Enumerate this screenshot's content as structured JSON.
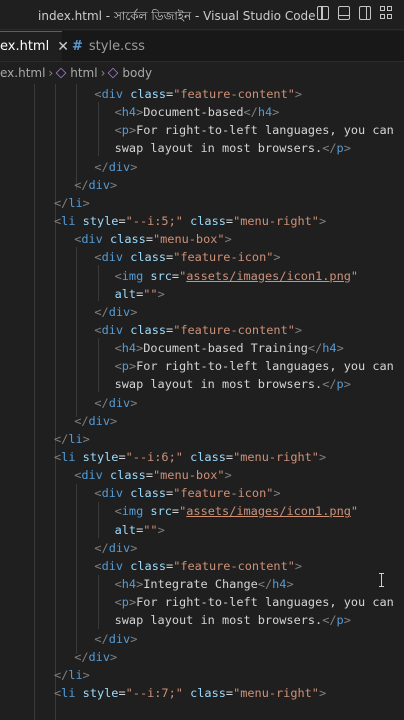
{
  "window": {
    "title": "index.html - সার্কেল ডিজাইন - Visual Studio Code"
  },
  "tabs": [
    {
      "label": "ex.html",
      "active": true,
      "close_icon": "close-icon"
    },
    {
      "label": "style.css",
      "active": false,
      "icon": "hash-icon"
    }
  ],
  "breadcrumb": {
    "file": "ex.html",
    "items": [
      "html",
      "body"
    ]
  },
  "code_lines": [
    {
      "indent": 5,
      "tokens": [
        [
          "p",
          "<"
        ],
        [
          "t",
          "div"
        ],
        [
          "x",
          " "
        ],
        [
          "a",
          "class"
        ],
        [
          "x",
          "="
        ],
        [
          "s",
          "\"feature-content\""
        ],
        [
          "p",
          ">"
        ]
      ]
    },
    {
      "indent": 6,
      "tokens": [
        [
          "p",
          "<"
        ],
        [
          "t",
          "h4"
        ],
        [
          "p",
          ">"
        ],
        [
          "x",
          "Document-based"
        ],
        [
          "p",
          "</"
        ],
        [
          "t",
          "h4"
        ],
        [
          "p",
          ">"
        ]
      ]
    },
    {
      "indent": 6,
      "tokens": [
        [
          "p",
          "<"
        ],
        [
          "t",
          "p"
        ],
        [
          "p",
          ">"
        ],
        [
          "x",
          "For right-to-left languages, you can"
        ]
      ]
    },
    {
      "indent": 6,
      "tokens": [
        [
          "x",
          "swap layout in most browsers."
        ],
        [
          "p",
          "</"
        ],
        [
          "t",
          "p"
        ],
        [
          "p",
          ">"
        ]
      ]
    },
    {
      "indent": 5,
      "tokens": [
        [
          "p",
          "</"
        ],
        [
          "t",
          "div"
        ],
        [
          "p",
          ">"
        ]
      ]
    },
    {
      "indent": 4,
      "tokens": [
        [
          "p",
          "</"
        ],
        [
          "t",
          "div"
        ],
        [
          "p",
          ">"
        ]
      ]
    },
    {
      "indent": 3,
      "tokens": [
        [
          "p",
          "</"
        ],
        [
          "t",
          "li"
        ],
        [
          "p",
          ">"
        ]
      ]
    },
    {
      "indent": 3,
      "tokens": [
        [
          "p",
          "<"
        ],
        [
          "t",
          "li"
        ],
        [
          "x",
          " "
        ],
        [
          "a",
          "style"
        ],
        [
          "x",
          "="
        ],
        [
          "s",
          "\"--i:5;\""
        ],
        [
          "x",
          " "
        ],
        [
          "a",
          "class"
        ],
        [
          "x",
          "="
        ],
        [
          "s",
          "\"menu-right\""
        ],
        [
          "p",
          ">"
        ]
      ]
    },
    {
      "indent": 4,
      "tokens": [
        [
          "p",
          "<"
        ],
        [
          "t",
          "div"
        ],
        [
          "x",
          " "
        ],
        [
          "a",
          "class"
        ],
        [
          "x",
          "="
        ],
        [
          "s",
          "\"menu-box\""
        ],
        [
          "p",
          ">"
        ]
      ]
    },
    {
      "indent": 5,
      "tokens": [
        [
          "p",
          "<"
        ],
        [
          "t",
          "div"
        ],
        [
          "x",
          " "
        ],
        [
          "a",
          "class"
        ],
        [
          "x",
          "="
        ],
        [
          "s",
          "\"feature-icon\""
        ],
        [
          "p",
          ">"
        ]
      ]
    },
    {
      "indent": 6,
      "tokens": [
        [
          "p",
          "<"
        ],
        [
          "t",
          "img"
        ],
        [
          "x",
          " "
        ],
        [
          "a",
          "src"
        ],
        [
          "x",
          "="
        ],
        [
          "s",
          "\""
        ],
        [
          "u",
          "assets/images/icon1.png"
        ],
        [
          "s",
          "\""
        ]
      ]
    },
    {
      "indent": 6,
      "tokens": [
        [
          "a",
          "alt"
        ],
        [
          "x",
          "="
        ],
        [
          "s",
          "\"\""
        ],
        [
          "p",
          ">"
        ]
      ]
    },
    {
      "indent": 5,
      "tokens": [
        [
          "p",
          "</"
        ],
        [
          "t",
          "div"
        ],
        [
          "p",
          ">"
        ]
      ]
    },
    {
      "indent": 5,
      "tokens": [
        [
          "p",
          "<"
        ],
        [
          "t",
          "div"
        ],
        [
          "x",
          " "
        ],
        [
          "a",
          "class"
        ],
        [
          "x",
          "="
        ],
        [
          "s",
          "\"feature-content\""
        ],
        [
          "p",
          ">"
        ]
      ]
    },
    {
      "indent": 6,
      "tokens": [
        [
          "p",
          "<"
        ],
        [
          "t",
          "h4"
        ],
        [
          "p",
          ">"
        ],
        [
          "x",
          "Document-based Training"
        ],
        [
          "p",
          "</"
        ],
        [
          "t",
          "h4"
        ],
        [
          "p",
          ">"
        ]
      ]
    },
    {
      "indent": 6,
      "tokens": [
        [
          "p",
          "<"
        ],
        [
          "t",
          "p"
        ],
        [
          "p",
          ">"
        ],
        [
          "x",
          "For right-to-left languages, you can"
        ]
      ]
    },
    {
      "indent": 6,
      "tokens": [
        [
          "x",
          "swap layout in most browsers."
        ],
        [
          "p",
          "</"
        ],
        [
          "t",
          "p"
        ],
        [
          "p",
          ">"
        ]
      ]
    },
    {
      "indent": 5,
      "tokens": [
        [
          "p",
          "</"
        ],
        [
          "t",
          "div"
        ],
        [
          "p",
          ">"
        ]
      ]
    },
    {
      "indent": 4,
      "tokens": [
        [
          "p",
          "</"
        ],
        [
          "t",
          "div"
        ],
        [
          "p",
          ">"
        ]
      ]
    },
    {
      "indent": 3,
      "tokens": [
        [
          "p",
          "</"
        ],
        [
          "t",
          "li"
        ],
        [
          "p",
          ">"
        ]
      ]
    },
    {
      "indent": 3,
      "tokens": [
        [
          "p",
          "<"
        ],
        [
          "t",
          "li"
        ],
        [
          "x",
          " "
        ],
        [
          "a",
          "style"
        ],
        [
          "x",
          "="
        ],
        [
          "s",
          "\"--i:6;\""
        ],
        [
          "x",
          " "
        ],
        [
          "a",
          "class"
        ],
        [
          "x",
          "="
        ],
        [
          "s",
          "\"menu-right\""
        ],
        [
          "p",
          ">"
        ]
      ]
    },
    {
      "indent": 4,
      "tokens": [
        [
          "p",
          "<"
        ],
        [
          "t",
          "div"
        ],
        [
          "x",
          " "
        ],
        [
          "a",
          "class"
        ],
        [
          "x",
          "="
        ],
        [
          "s",
          "\"menu-box\""
        ],
        [
          "p",
          ">"
        ]
      ]
    },
    {
      "indent": 5,
      "tokens": [
        [
          "p",
          "<"
        ],
        [
          "t",
          "div"
        ],
        [
          "x",
          " "
        ],
        [
          "a",
          "class"
        ],
        [
          "x",
          "="
        ],
        [
          "s",
          "\"feature-icon\""
        ],
        [
          "p",
          ">"
        ]
      ]
    },
    {
      "indent": 6,
      "tokens": [
        [
          "p",
          "<"
        ],
        [
          "t",
          "img"
        ],
        [
          "x",
          " "
        ],
        [
          "a",
          "src"
        ],
        [
          "x",
          "="
        ],
        [
          "s",
          "\""
        ],
        [
          "u",
          "assets/images/icon1.png"
        ],
        [
          "s",
          "\""
        ]
      ]
    },
    {
      "indent": 6,
      "tokens": [
        [
          "a",
          "alt"
        ],
        [
          "x",
          "="
        ],
        [
          "s",
          "\"\""
        ],
        [
          "p",
          ">"
        ]
      ]
    },
    {
      "indent": 5,
      "tokens": [
        [
          "p",
          "</"
        ],
        [
          "t",
          "div"
        ],
        [
          "p",
          ">"
        ]
      ]
    },
    {
      "indent": 5,
      "tokens": [
        [
          "p",
          "<"
        ],
        [
          "t",
          "div"
        ],
        [
          "x",
          " "
        ],
        [
          "a",
          "class"
        ],
        [
          "x",
          "="
        ],
        [
          "s",
          "\"feature-content\""
        ],
        [
          "p",
          ">"
        ]
      ]
    },
    {
      "indent": 6,
      "tokens": [
        [
          "p",
          "<"
        ],
        [
          "t",
          "h4"
        ],
        [
          "p",
          ">"
        ],
        [
          "x",
          "Integrate Change"
        ],
        [
          "p",
          "</"
        ],
        [
          "t",
          "h4"
        ],
        [
          "p",
          ">"
        ]
      ]
    },
    {
      "indent": 6,
      "tokens": [
        [
          "p",
          "<"
        ],
        [
          "t",
          "p"
        ],
        [
          "p",
          ">"
        ],
        [
          "x",
          "For right-to-left languages, you can"
        ]
      ]
    },
    {
      "indent": 6,
      "tokens": [
        [
          "x",
          "swap layout in most browsers."
        ],
        [
          "p",
          "</"
        ],
        [
          "t",
          "p"
        ],
        [
          "p",
          ">"
        ]
      ]
    },
    {
      "indent": 5,
      "tokens": [
        [
          "p",
          "</"
        ],
        [
          "t",
          "div"
        ],
        [
          "p",
          ">"
        ]
      ]
    },
    {
      "indent": 4,
      "tokens": [
        [
          "p",
          "</"
        ],
        [
          "t",
          "div"
        ],
        [
          "p",
          ">"
        ]
      ]
    },
    {
      "indent": 3,
      "tokens": [
        [
          "p",
          "</"
        ],
        [
          "t",
          "li"
        ],
        [
          "p",
          ">"
        ]
      ]
    },
    {
      "indent": 3,
      "tokens": [
        [
          "p",
          "<"
        ],
        [
          "t",
          "li"
        ],
        [
          "x",
          " "
        ],
        [
          "a",
          "style"
        ],
        [
          "x",
          "="
        ],
        [
          "s",
          "\"--i:7;\""
        ],
        [
          "x",
          " "
        ],
        [
          "a",
          "class"
        ],
        [
          "x",
          "="
        ],
        [
          "s",
          "\"menu-right\""
        ],
        [
          "p",
          ">"
        ]
      ]
    }
  ],
  "colors": {
    "tag": "#569cd6",
    "attribute": "#9cdcfe",
    "string": "#ce9178",
    "punctuation": "#808080",
    "text": "#d4d4d4",
    "editor_bg": "#1f1f1f"
  }
}
